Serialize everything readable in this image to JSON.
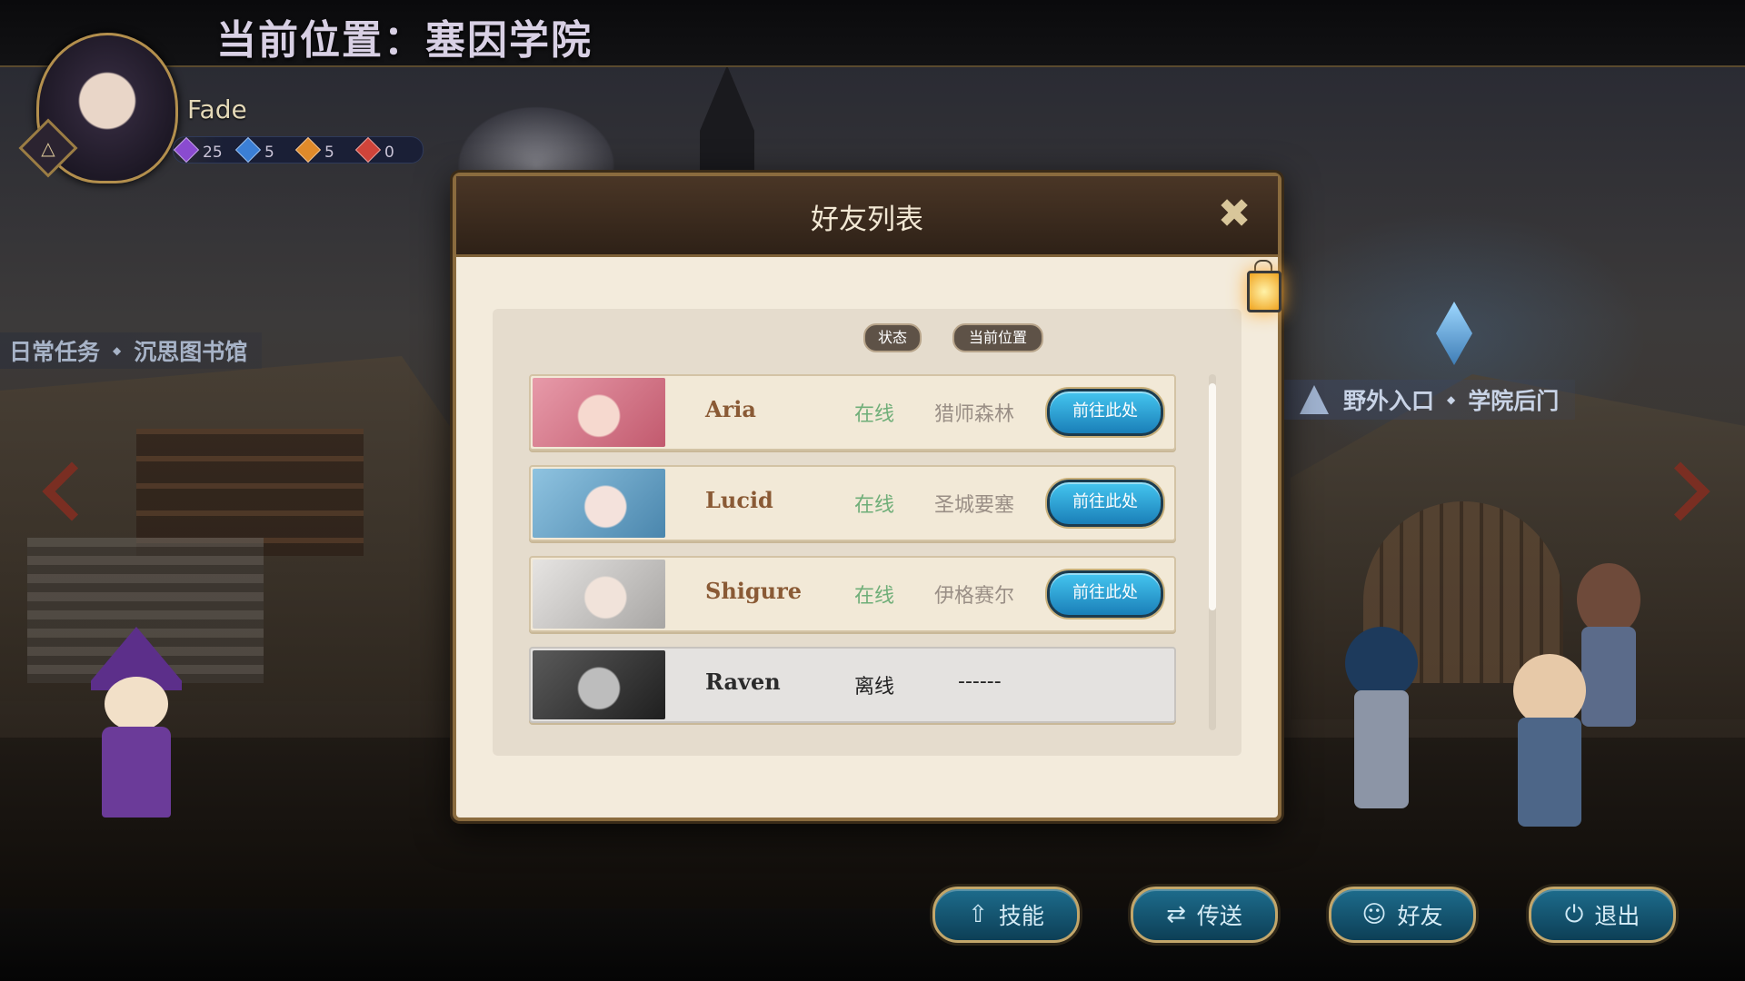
{
  "location_title": "当前位置：塞因学院",
  "player": {
    "name": "Fade",
    "resources": [
      {
        "icon": "purple-gem-icon",
        "value": "25",
        "color": "#8a4bd0"
      },
      {
        "icon": "blue-cross-gem-icon",
        "value": "5",
        "color": "#3b7fd6"
      },
      {
        "icon": "orange-gem-icon",
        "value": "5",
        "color": "#e08a2a"
      },
      {
        "icon": "red-gem-icon",
        "value": "0",
        "color": "#d0443a"
      }
    ]
  },
  "side_locations": {
    "left": {
      "a": "日常任务",
      "b": "沉思图书馆"
    },
    "right": {
      "a": "野外入口",
      "b": "学院后门"
    }
  },
  "dialog": {
    "title": "好友列表",
    "close_label": "✖",
    "column_status": "状态",
    "column_location": "当前位置",
    "friends": [
      {
        "name": "Aria",
        "status": "在线",
        "location": "猎师森林",
        "button": "前往此处",
        "avatar_color": "#e79aa9"
      },
      {
        "name": "Lucid",
        "status": "在线",
        "location": "圣城要塞",
        "button": "前往此处",
        "avatar_color": "#8fc3e0"
      },
      {
        "name": "Shigure",
        "status": "在线",
        "location": "伊格赛尔",
        "button": "前往此处",
        "avatar_color": "#d8d6d4"
      },
      {
        "name": "Raven",
        "status": "离线",
        "location": "------",
        "avatar_color": "#4a4a4a"
      }
    ]
  },
  "bottom_menu": {
    "skill": "技能",
    "teleport": "传送",
    "friends": "好友",
    "exit": "退出"
  }
}
